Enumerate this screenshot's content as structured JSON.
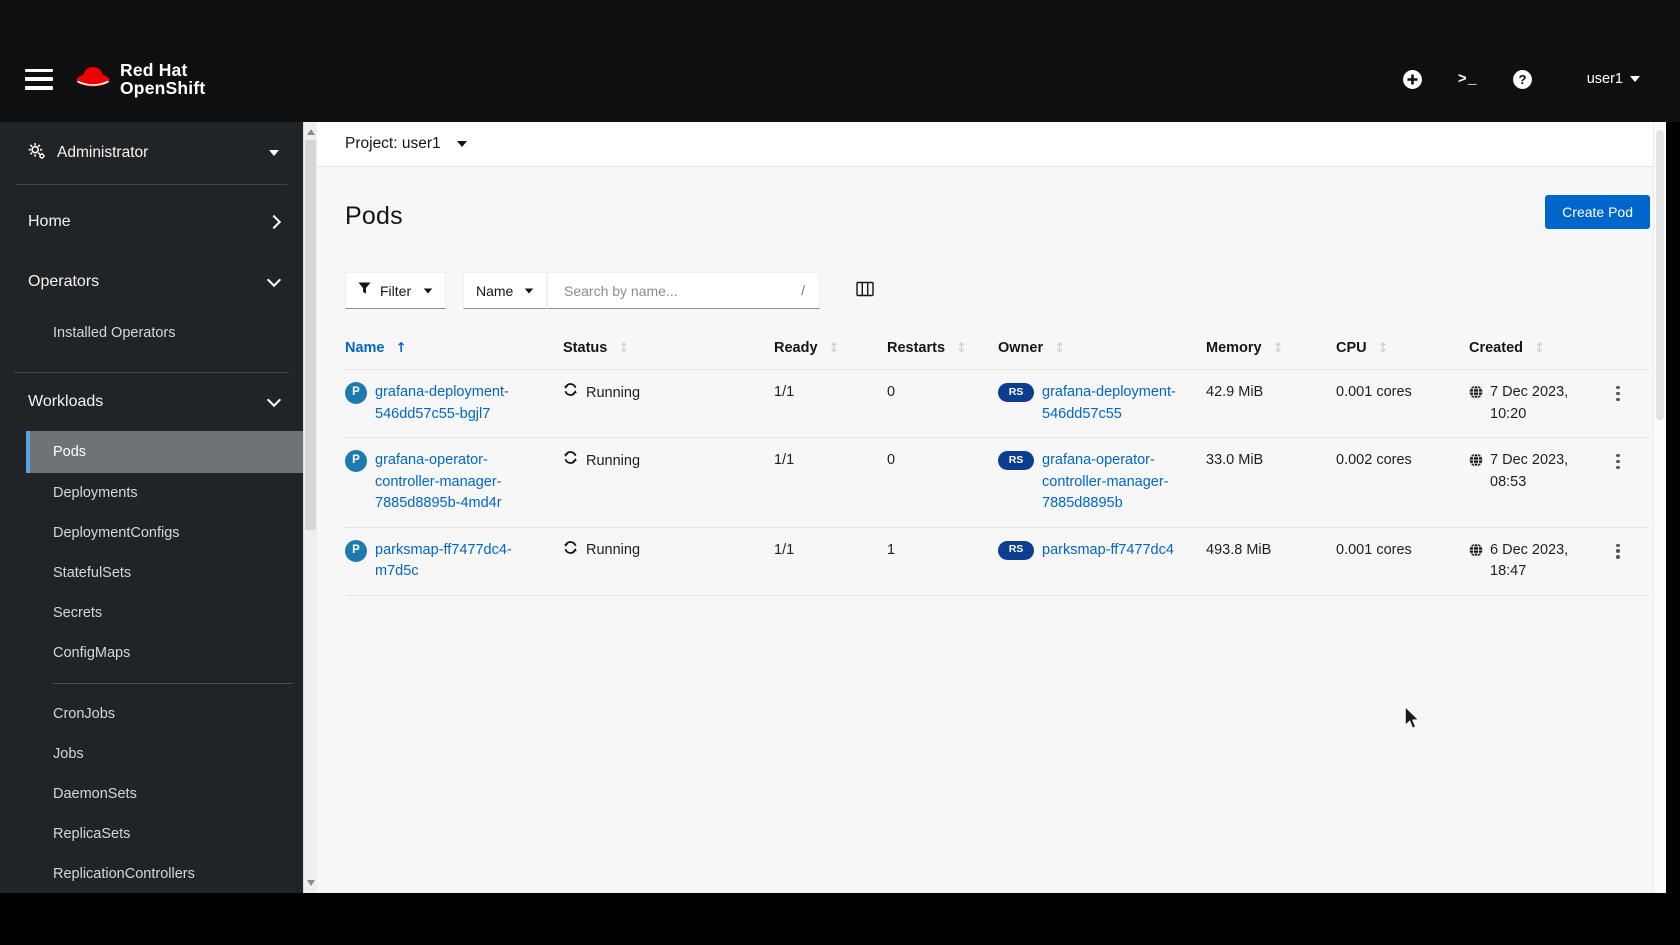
{
  "masthead": {
    "brand_line1": "Red Hat",
    "brand_line2": "OpenShift",
    "user_label": "user1"
  },
  "perspective": {
    "label": "Administrator"
  },
  "sidebar": {
    "items": {
      "home": "Home",
      "operators": "Operators",
      "installed_operators": "Installed Operators",
      "workloads": "Workloads",
      "pods": "Pods",
      "deployments": "Deployments",
      "deploymentconfigs": "DeploymentConfigs",
      "statefulsets": "StatefulSets",
      "secrets": "Secrets",
      "configmaps": "ConfigMaps",
      "cronjobs": "CronJobs",
      "jobs": "Jobs",
      "daemonsets": "DaemonSets",
      "replicasets": "ReplicaSets",
      "replicationcontrollers": "ReplicationControllers"
    }
  },
  "page": {
    "project_selector": "Project: user1",
    "title": "Pods",
    "create_button": "Create Pod"
  },
  "toolbar": {
    "filter_label": "Filter",
    "attribute_label": "Name",
    "search_placeholder": "Search by name...",
    "search_shortcut": "/"
  },
  "table": {
    "columns": [
      "Name",
      "Status",
      "Ready",
      "Restarts",
      "Owner",
      "Memory",
      "CPU",
      "Created"
    ],
    "sorted_column": "Name",
    "rows": [
      {
        "badge": "P",
        "name": "grafana-deployment-546dd57c55-bgjl7",
        "status": "Running",
        "ready": "1/1",
        "restarts": "0",
        "owner_badge": "RS",
        "owner": "grafana-deployment-546dd57c55",
        "memory": "42.9 MiB",
        "cpu": "0.001 cores",
        "created_date": "7 Dec 2023,",
        "created_time": "10:20"
      },
      {
        "badge": "P",
        "name": "grafana-operator-controller-manager-7885d8895b-4md4r",
        "status": "Running",
        "ready": "1/1",
        "restarts": "0",
        "owner_badge": "RS",
        "owner": "grafana-operator-controller-manager-7885d8895b",
        "memory": "33.0 MiB",
        "cpu": "0.002 cores",
        "created_date": "7 Dec 2023,",
        "created_time": "08:53"
      },
      {
        "badge": "P",
        "name": "parksmap-ff7477dc4-m7d5c",
        "status": "Running",
        "ready": "1/1",
        "restarts": "1",
        "owner_badge": "RS",
        "owner": "parksmap-ff7477dc4",
        "memory": "493.8 MiB",
        "cpu": "0.001 cores",
        "created_date": "6 Dec 2023,",
        "created_time": "18:47"
      }
    ]
  },
  "colors": {
    "accent_blue": "#0066cc",
    "link_blue": "#0066cc",
    "pod_badge_blue": "#1d7ab0",
    "replicaset_badge_navy": "#0d3d8f",
    "brand_red": "#ee0000",
    "nav_selected_bg": "#6f7277",
    "nav_selected_border": "#5ba3dd",
    "masthead_bg": "#0d0f11",
    "sidebar_bg": "#212427"
  }
}
